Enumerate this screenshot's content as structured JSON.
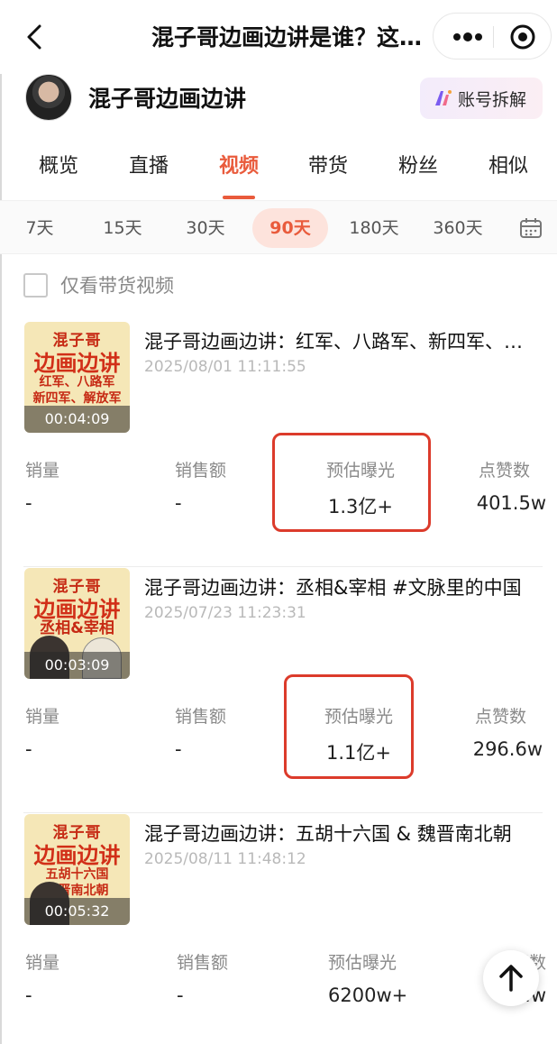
{
  "header": {
    "title": "混子哥边画边讲是谁？这…"
  },
  "account": {
    "name": "混子哥边画边讲",
    "disassemble_label": "账号拆解"
  },
  "tabs": [
    {
      "label": "概览"
    },
    {
      "label": "直播"
    },
    {
      "label": "视频",
      "active": true
    },
    {
      "label": "带货"
    },
    {
      "label": "粉丝"
    },
    {
      "label": "相似"
    }
  ],
  "periods": [
    {
      "label": "7天"
    },
    {
      "label": "15天"
    },
    {
      "label": "30天"
    },
    {
      "label": "90天",
      "active": true
    },
    {
      "label": "180天"
    },
    {
      "label": "360天"
    }
  ],
  "filter": {
    "label": "仅看带货视频",
    "checked": false
  },
  "metric_labels": {
    "sales": "销量",
    "revenue": "销售额",
    "exposure": "预估曝光",
    "likes": "点赞数"
  },
  "videos": [
    {
      "title": "混子哥边画边讲：红军、八路军、新四军、解放军",
      "date": "2025/08/01 11:11:55",
      "duration": "00:04:09",
      "thumb_line1": "混子哥",
      "thumb_line2": "边画边讲",
      "thumb_line3": "红军、八路军\n新四军、解放军",
      "sales": "-",
      "revenue": "-",
      "exposure": "1.3亿+",
      "likes": "401.5w"
    },
    {
      "title": "混子哥边画边讲：丞相&宰相 #文脉里的中国",
      "date": "2025/07/23 11:23:31",
      "duration": "00:03:09",
      "thumb_line1": "混子哥",
      "thumb_line2": "边画边讲",
      "thumb_line3": "丞相&宰相",
      "sales": "-",
      "revenue": "-",
      "exposure": "1.1亿+",
      "likes": "296.6w"
    },
    {
      "title": "混子哥边画边讲：五胡十六国 & 魏晋南北朝",
      "date": "2025/08/11 11:48:12",
      "duration": "00:05:32",
      "thumb_line1": "混子哥",
      "thumb_line2": "边画边讲",
      "thumb_line3": "五胡十六国\n魏晋南北朝",
      "sales": "-",
      "revenue": "-",
      "exposure": "6200w+",
      "likes": "1…w"
    }
  ],
  "colors": {
    "accent": "#e95b3c",
    "highlight_box": "#dc3b2b"
  },
  "icons": {
    "back": "back-chevron-icon",
    "more": "more-dots-icon",
    "close_target": "target-circle-icon",
    "calendar": "calendar-icon",
    "to_top": "arrow-up-icon"
  }
}
